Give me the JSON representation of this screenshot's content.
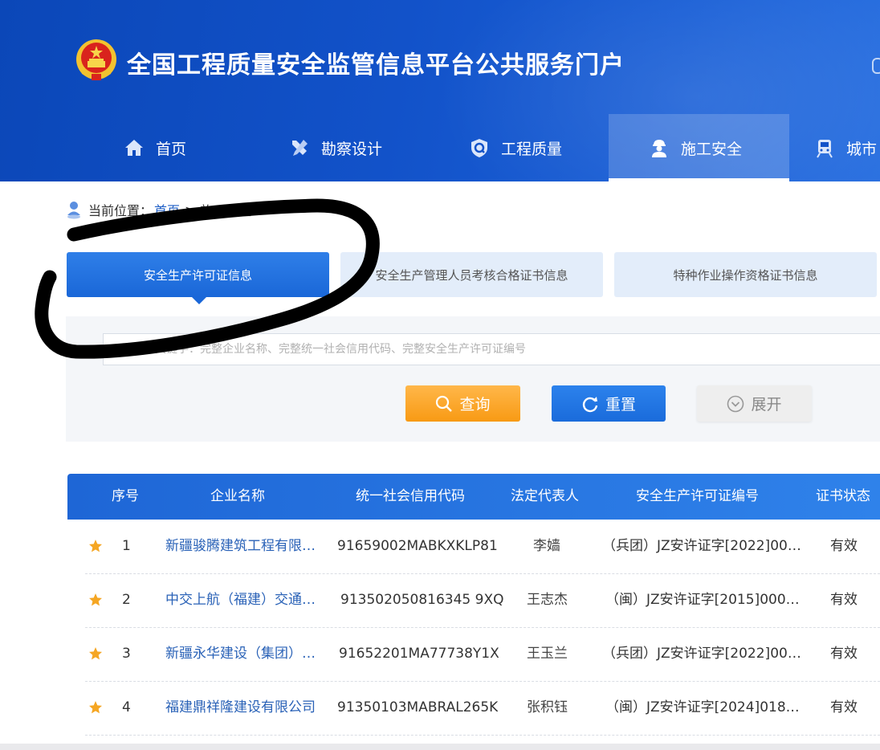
{
  "header": {
    "site_title": "全国工程质量安全监管信息平台公共服务门户",
    "nav": [
      {
        "label": "首页",
        "icon": "home-icon"
      },
      {
        "label": "勘察设计",
        "icon": "tools-icon"
      },
      {
        "label": "工程质量",
        "icon": "shield-icon"
      },
      {
        "label": "施工安全",
        "icon": "worker-icon",
        "active": true
      },
      {
        "label": "城市",
        "icon": "train-icon"
      }
    ]
  },
  "breadcrumb": {
    "prefix": "当前位置：",
    "home": "首页",
    "separator": ">",
    "current": "施工安全"
  },
  "tabs": [
    {
      "label": "安全生产许可证信息",
      "active": true
    },
    {
      "label": "安全生产管理人员考核合格证书信息"
    },
    {
      "label": "特种作业操作资格证书信息"
    }
  ],
  "search": {
    "placeholder": "请输入关键字：完整企业名称、完整统一社会信用代码、完整安全生产许可证编号",
    "query_label": "查询",
    "reset_label": "重置",
    "expand_label": "展开"
  },
  "table": {
    "columns": [
      "序号",
      "企业名称",
      "统一社会信用代码",
      "法定代表人",
      "安全生产许可证编号",
      "证书状态"
    ],
    "rows": [
      {
        "no": "1",
        "name": "新疆骏腾建筑工程有限…",
        "code": "91659002MABKXKLP81",
        "rep": "李嫱",
        "license": "（兵团）JZ安许证字[2022]00…",
        "status": "有效"
      },
      {
        "no": "2",
        "name": "中交上航（福建）交通…",
        "code": "913502050816345 9XQ",
        "rep": "王志杰",
        "license": "（闽）JZ安许证字[2015]000…",
        "status": "有效"
      },
      {
        "no": "3",
        "name": "新疆永华建设（集团）…",
        "code": "91652201MA77738Y1X",
        "rep": "王玉兰",
        "license": "（兵团）JZ安许证字[2022]00…",
        "status": "有效"
      },
      {
        "no": "4",
        "name": "福建鼎祥隆建设有限公司",
        "code": "91350103MABRAL265K",
        "rep": "张积钰",
        "license": "（闽）JZ安许证字[2024]018…",
        "status": "有效"
      }
    ]
  },
  "colors": {
    "header_blue": "#1252c9",
    "accent_blue": "#1a67d8",
    "query_orange": "#f89a14",
    "star_orange": "#f5a623",
    "link_blue": "#2a62b7",
    "scribble": "#000000"
  }
}
